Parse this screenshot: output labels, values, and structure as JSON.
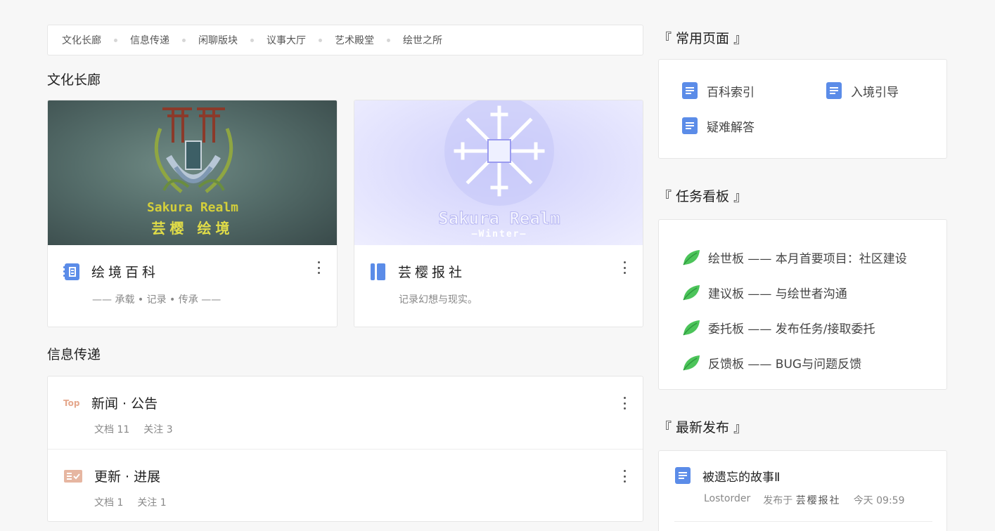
{
  "nav": {
    "items": [
      "文化长廊",
      "信息传递",
      "闲聊版块",
      "议事大厅",
      "艺术殿堂",
      "绘世之所"
    ]
  },
  "sections": {
    "culture": "文化长廊",
    "info": "信息传递"
  },
  "cards": [
    {
      "title": "绘境百科",
      "subtitle": "—— 承载 • 记录 • 传承 ——",
      "icon": "book-index-icon",
      "banner_text": [
        "Sakura Realm",
        "芸樱 绘境"
      ]
    },
    {
      "title": "芸樱报社",
      "subtitle": "记录幻想与现实。",
      "icon": "notebook-icon",
      "banner_text": [
        "Sakura Realm",
        "—Winter—"
      ]
    }
  ],
  "info_list": [
    {
      "badge": "Top",
      "title": "新闻 · 公告",
      "docs": "文档 11",
      "follow": "关注 3",
      "icon": "top-badge-icon"
    },
    {
      "title": "更新 · 进展",
      "docs": "文档 1",
      "follow": "关注 1",
      "icon": "checklist-icon"
    }
  ],
  "sidebar": {
    "common_title": "『 常用页面 』",
    "common_links": [
      "百科索引",
      "入境引导",
      "疑难解答"
    ],
    "tasks_title": "『 任务看板 』",
    "tasks": [
      "绘世板 —— 本月首要项目：社区建设",
      "建议板 —— 与绘世者沟通",
      "委托板 —— 发布任务/接取委托",
      "反馈板 —— BUG与问题反馈"
    ],
    "latest_title": "『 最新发布 』",
    "latest": {
      "title": "被遗忘的故事Ⅱ",
      "author": "Lostorder",
      "published_in": "发布于",
      "source": "芸樱报社",
      "time": "今天 09:59"
    }
  },
  "colors": {
    "accent_blue": "#5b8ce8",
    "leaf_green": "#4cc45a",
    "top_badge": "#e5a88d"
  }
}
